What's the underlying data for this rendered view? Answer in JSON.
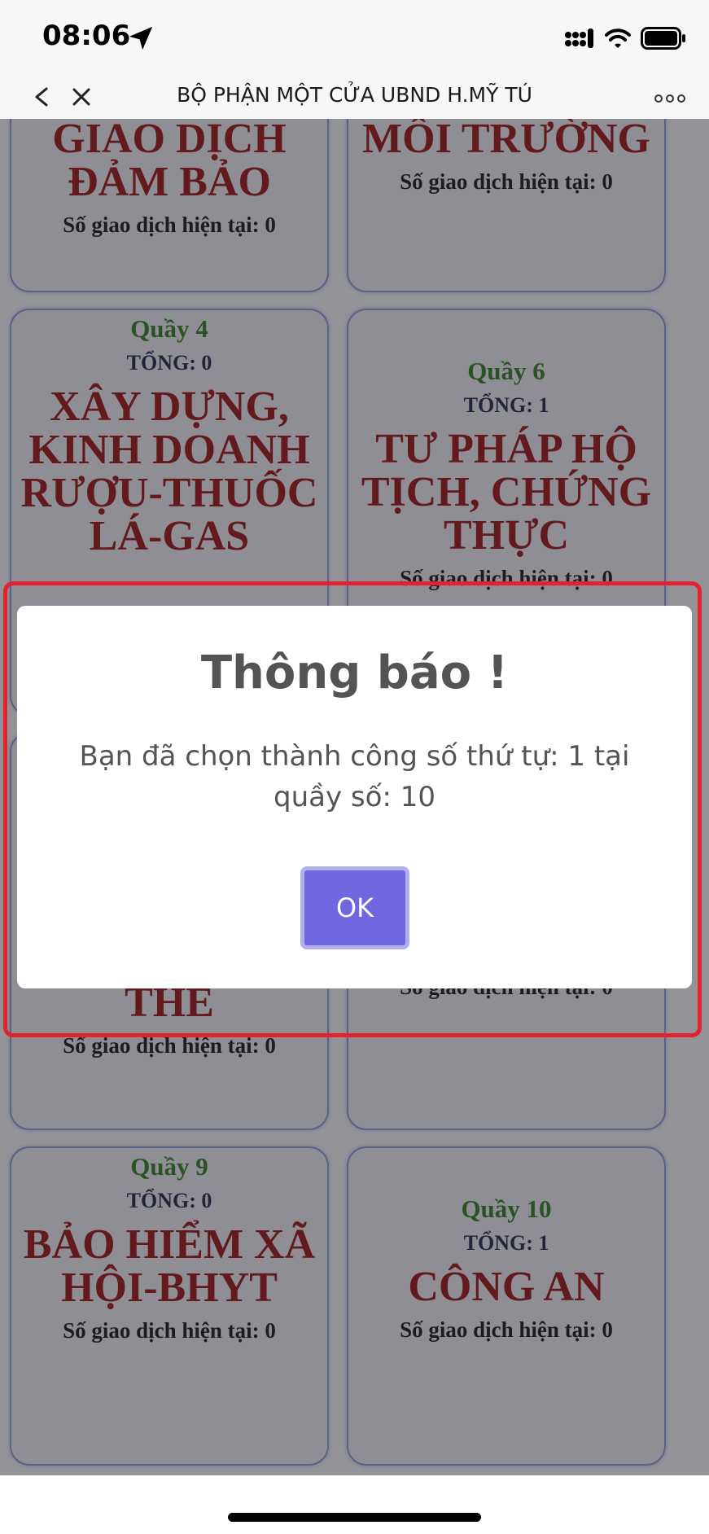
{
  "status_bar": {
    "time": "08:06"
  },
  "nav": {
    "title": "BỘ PHẬN MỘT CỬA UBND H.MỸ TÚ"
  },
  "cards": [
    {
      "name": "GIAO DỊCH ĐẢM BẢO",
      "current": "Số giao dịch hiện tại: 0"
    },
    {
      "name": "MÔI TRƯỜNG",
      "current": "Số giao dịch hiện tại: 0"
    },
    {
      "counter": "Quầy 4",
      "total": "TỔNG: 0",
      "name": "XÂY DỰNG, KINH DOANH RƯỢU-THUỐC LÁ-GAS"
    },
    {
      "counter": "Quầy 6",
      "total": "TỔNG: 1",
      "name": "TƯ PHÁP HỘ TỊCH, CHỨNG THỰC",
      "current": "Số giao dịch hiện tại: 0"
    },
    {
      "name": "THẺ",
      "current": "Số giao dịch hiện tại: 0"
    },
    {
      "current": "Số giao dịch hiện tại: 0"
    },
    {
      "counter": "Quầy 9",
      "total": "TỔNG: 0",
      "name": "BẢO HIỂM XÃ HỘI-BHYT",
      "current": "Số giao dịch hiện tại: 0"
    },
    {
      "counter": "Quầy 10",
      "total": "TỔNG: 1",
      "name": "CÔNG AN",
      "current": "Số giao dịch hiện tại: 0"
    }
  ],
  "dialog": {
    "title": "Thông báo !",
    "message": "Bạn đã chọn thành công số thứ tự: 1 tại quầy số: 10",
    "ok_label": "OK"
  },
  "colors": {
    "counter": "#2e7d18",
    "card_name": "#9c0c0c",
    "ok_button": "#7066e0",
    "highlight": "#e2222c"
  }
}
